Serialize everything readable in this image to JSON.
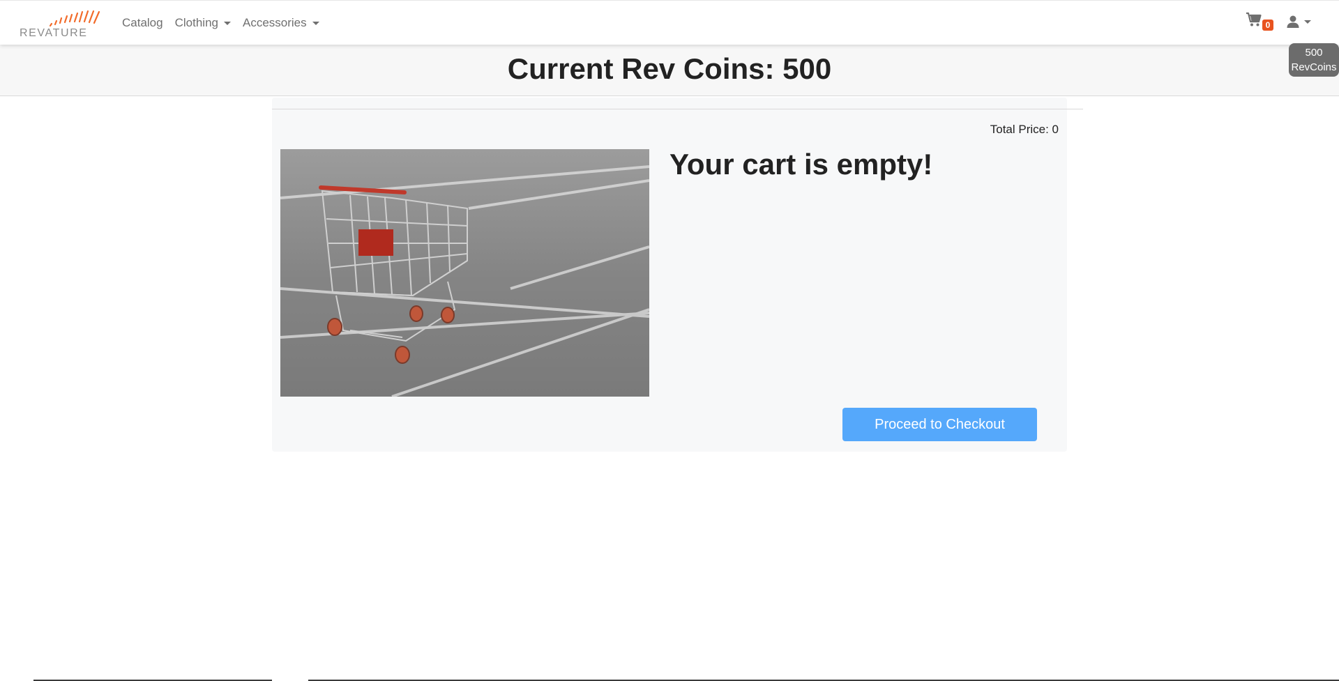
{
  "brand": {
    "logo_text": "REVATURE",
    "accent": "#e8531f"
  },
  "nav": {
    "links": [
      {
        "label": "Catalog",
        "has_dropdown": false
      },
      {
        "label": "Clothing",
        "has_dropdown": true
      },
      {
        "label": "Accessories",
        "has_dropdown": true
      }
    ],
    "cart_count": "0",
    "cart_icon": "cart-icon",
    "user_icon": "user-icon"
  },
  "coin_pill": {
    "amount": "500",
    "unit": "RevCoins"
  },
  "banner": {
    "title": "Current Rev Coins: 500"
  },
  "cart": {
    "total_price_label": "Total Price: 0",
    "empty_message": "Your cart is empty!",
    "checkout_label": "Proceed to Checkout",
    "checkout_color": "#55a8fb"
  }
}
